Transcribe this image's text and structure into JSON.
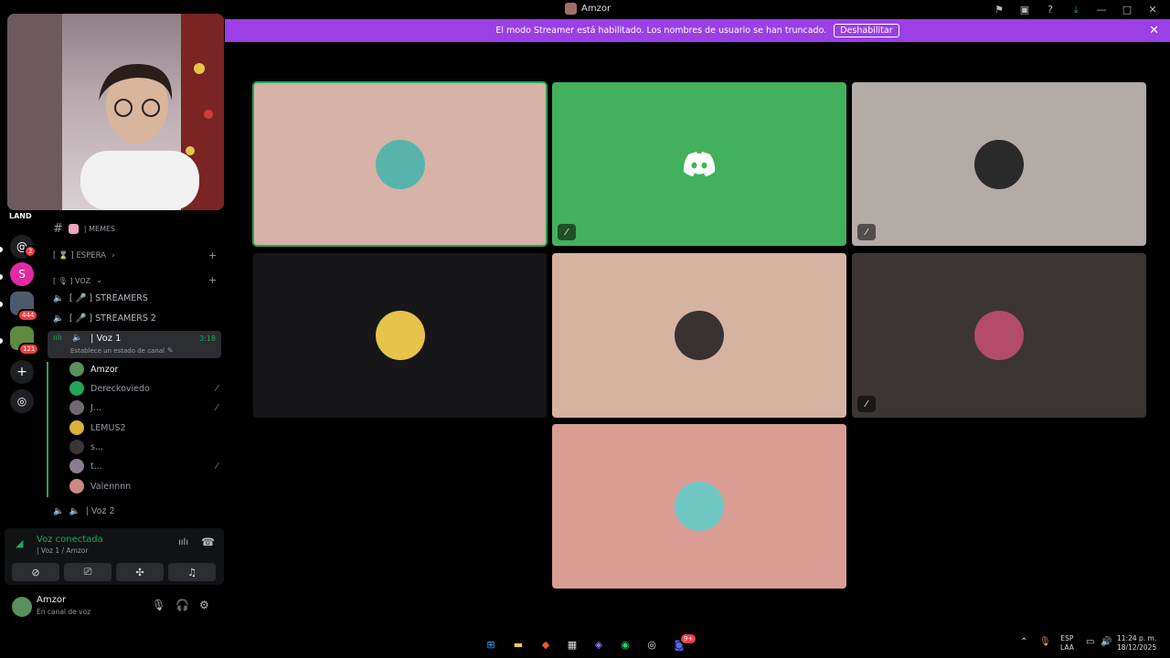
{
  "window": {
    "title": "Amzor"
  },
  "titlebar_icons": [
    "flag-icon",
    "inbox-icon",
    "help-icon",
    "download-icon",
    "minimize-icon",
    "maximize-icon",
    "close-icon"
  ],
  "banner": {
    "text": "El modo Streamer está habilitado. Los nombres de usuario se han truncado.",
    "button": "Deshabilitar"
  },
  "servers": {
    "badges": [
      "2",
      "444",
      "121"
    ],
    "letter_server": "S"
  },
  "channels": {
    "server_logo": "LAND",
    "memes": "| MEMES",
    "cat_espera": "[ ⌛ ] ESPERA",
    "cat_voz": "[ 🎙 ] VOZ",
    "streamers": "[ 🎤 ] STREAMERS",
    "streamers2": "[ 🎤 ] STREAMERS 2",
    "voz1": "| Voz 1",
    "voz1_time": "3:18",
    "voz1_status": "Establece un estado de canal",
    "voz2": "| Voz 2"
  },
  "voice_users": [
    {
      "name": "Amzor",
      "color": "#5a8f5e",
      "muted": false,
      "bright": true
    },
    {
      "name": "Dereckoviedo",
      "color": "#23a55a",
      "muted": true,
      "bright": false
    },
    {
      "name": "J...",
      "color": "#6e6a70",
      "muted": true,
      "bright": false
    },
    {
      "name": "LEMUS2",
      "color": "#d9b23a",
      "muted": false,
      "bright": false
    },
    {
      "name": "s...",
      "color": "#3a3536",
      "muted": false,
      "bright": false
    },
    {
      "name": "t...",
      "color": "#8a7e8e",
      "muted": true,
      "bright": false
    },
    {
      "name": "Valennnn",
      "color": "#c98a85",
      "muted": false,
      "bright": false
    }
  ],
  "voice_panel": {
    "status": "Voz conectada",
    "sub": "| Voz 1 / Amzor"
  },
  "user_panel": {
    "name": "Amzor",
    "status": "En canal de voz"
  },
  "tiles": [
    {
      "bg": "#d6b3a6",
      "avatar": "#58b3ad",
      "muted": false,
      "speaking": true
    },
    {
      "bg": "#43b05c",
      "avatar": "discord",
      "muted": true,
      "speaking": false
    },
    {
      "bg": "#b3aba8",
      "avatar": "#2a2a2a",
      "muted": true,
      "speaking": false
    },
    {
      "bg": "#17171a",
      "avatar": "#e8c34a",
      "muted": false,
      "speaking": false
    },
    {
      "bg": "#d6b3a0",
      "avatar": "#3a3132",
      "muted": false,
      "speaking": false
    },
    {
      "bg": "#3b3534",
      "avatar": "#b34b6a",
      "muted": true,
      "speaking": false
    },
    {
      "bg": "#da9d94",
      "avatar": "#6fc7c4",
      "muted": false,
      "speaking": false
    }
  ],
  "taskbar": {
    "lang": "ESP",
    "lang2": "LAA",
    "time": "11:24 p. m.",
    "date": "18/12/2025",
    "discord_badge": "9+"
  },
  "colors": {
    "banner": "#9b3fe6",
    "online_green": "#23a55a",
    "sidebar_bg": "#000000",
    "panel_bg": "#111214"
  }
}
